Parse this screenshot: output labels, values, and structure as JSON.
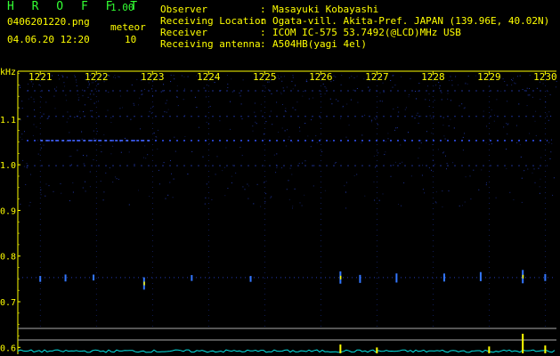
{
  "header": {
    "logo": "H R O F F T",
    "version": "1.00",
    "filename": "0406201220.png",
    "plot_type": "meteor",
    "datetime": "04.06.20 12:20",
    "count": "10"
  },
  "info": [
    {
      "key": "Observer",
      "value": "Masayuki Kobayashi"
    },
    {
      "key": "Receiving Location",
      "value": "Ogata-vill. Akita-Pref. JAPAN (139.96E, 40.02N)"
    },
    {
      "key": "Receiver",
      "value": "ICOM IC-575 53.7492(@LCD)MHz USB"
    },
    {
      "key": "Receiving antenna",
      "value": "A504HB(yagi 4el)"
    }
  ],
  "separator": ":",
  "colors": {
    "background": "#000000",
    "text": "#ffff00",
    "logo": "#33ff33",
    "signal": "#3355ff",
    "bright_echo": "#ffff00",
    "level_trace": "#00e5e5"
  },
  "chart_data": {
    "type": "heatmap",
    "title": "",
    "xlabel": "",
    "ylabel": "kHz",
    "x_ticks": [
      "1221",
      "1222",
      "1223",
      "1224",
      "1225",
      "1226",
      "1227",
      "1228",
      "1229",
      "1230"
    ],
    "xlim": [
      1220.6,
      1230.2
    ],
    "y_ticks": [
      "1.1",
      "1.0",
      "0.9",
      "0.8",
      "0.7",
      "0.6"
    ],
    "ylim": [
      0.585,
      1.205
    ],
    "persistent_lines_khz": [
      1.162,
      1.106,
      1.053,
      0.998
    ],
    "meteor_echo_band_khz": 0.753,
    "echoes": [
      {
        "t": 1221.0,
        "khz": 0.75,
        "strength": 0.3
      },
      {
        "t": 1221.45,
        "khz": 0.752,
        "strength": 0.4
      },
      {
        "t": 1221.95,
        "khz": 0.753,
        "strength": 0.3
      },
      {
        "t": 1222.85,
        "khz": 0.74,
        "strength": 0.9
      },
      {
        "t": 1223.7,
        "khz": 0.752,
        "strength": 0.3
      },
      {
        "t": 1224.75,
        "khz": 0.75,
        "strength": 0.3
      },
      {
        "t": 1226.35,
        "khz": 0.753,
        "strength": 0.9
      },
      {
        "t": 1226.7,
        "khz": 0.75,
        "strength": 0.5
      },
      {
        "t": 1227.35,
        "khz": 0.752,
        "strength": 0.6
      },
      {
        "t": 1228.2,
        "khz": 0.753,
        "strength": 0.5
      },
      {
        "t": 1228.85,
        "khz": 0.755,
        "strength": 0.6
      },
      {
        "t": 1229.6,
        "khz": 0.755,
        "strength": 1.0
      },
      {
        "t": 1230.0,
        "khz": 0.753,
        "strength": 0.4
      }
    ],
    "level_spikes": [
      {
        "t": 1226.35,
        "level": 0.45
      },
      {
        "t": 1227.0,
        "level": 0.3
      },
      {
        "t": 1229.0,
        "level": 0.35
      },
      {
        "t": 1229.6,
        "level": 1.0
      },
      {
        "t": 1230.0,
        "level": 0.4
      }
    ]
  }
}
